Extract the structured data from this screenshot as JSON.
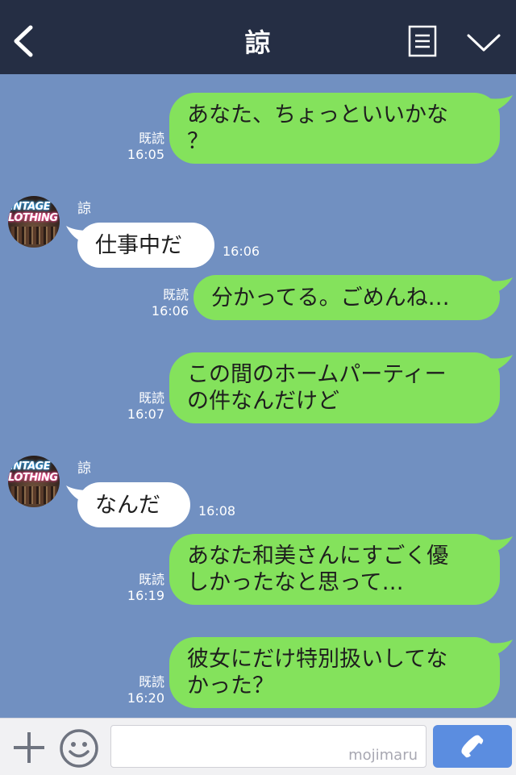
{
  "header": {
    "title": "諒",
    "back_icon": "chevron-left-icon",
    "menu_icon": "list-menu-icon",
    "dropdown_icon": "chevron-down-icon"
  },
  "messages": [
    {
      "side": "right",
      "lines": [
        "あなた、ちょっといいかな",
        "？"
      ],
      "read": "既読",
      "time": "16:05"
    },
    {
      "side": "left",
      "sender": "諒",
      "lines": [
        "仕事中だ"
      ],
      "time": "16:06"
    },
    {
      "side": "right",
      "lines": [
        "分かってる。ごめんね…"
      ],
      "read": "既読",
      "time": "16:06"
    },
    {
      "side": "right",
      "lines": [
        "この間のホームパーティー",
        "の件なんだけど"
      ],
      "read": "既読",
      "time": "16:07"
    },
    {
      "side": "left",
      "sender": "諒",
      "lines": [
        "なんだ"
      ],
      "time": "16:08"
    },
    {
      "side": "right",
      "lines": [
        "あなた和美さんにすごく優",
        "しかったなと思って…"
      ],
      "read": "既読",
      "time": "16:19"
    },
    {
      "side": "right",
      "lines": [
        "彼女にだけ特別扱いしてな",
        "かった？"
      ],
      "read": "既読",
      "time": "16:20"
    }
  ],
  "avatar": {
    "line1": "INTAGE",
    "line2": "LOTHING"
  },
  "input": {
    "placeholder": "",
    "watermark": "mojimaru",
    "plus_icon": "plus-icon",
    "emoji_icon": "smiley-icon",
    "call_icon": "phone-icon"
  },
  "colors": {
    "header_bg": "#252e44",
    "chat_bg": "#7190c1",
    "bubble_sent": "#84e25c",
    "bubble_received": "#ffffff",
    "call_button": "#5b8de0"
  }
}
